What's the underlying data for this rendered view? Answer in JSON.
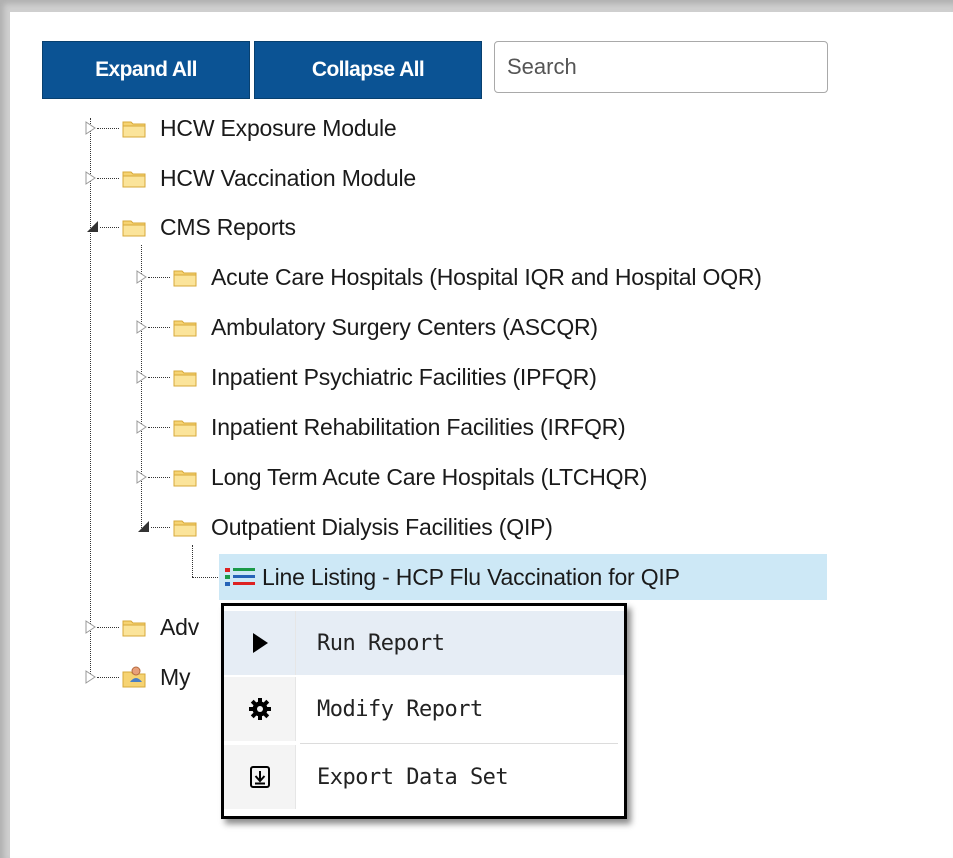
{
  "toolbar": {
    "expand_label": "Expand All",
    "collapse_label": "Collapse All",
    "search_placeholder": "Search"
  },
  "tree": {
    "hcw_exposure": "HCW Exposure Module",
    "hcw_vaccination": "HCW Vaccination Module",
    "cms_reports": "CMS Reports",
    "acute_care": "Acute Care Hospitals (Hospital IQR and Hospital OQR)",
    "ambulatory": "Ambulatory Surgery Centers (ASCQR)",
    "inpatient_psych": "Inpatient Psychiatric Facilities (IPFQR)",
    "inpatient_rehab": "Inpatient Rehabilitation Facilities (IRFQR)",
    "long_term": "Long Term Acute Care Hospitals (LTCHQR)",
    "outpatient_dialysis": "Outpatient Dialysis Facilities (QIP)",
    "line_listing": "Line Listing - HCP Flu Vaccination for QIP",
    "advanced_partial": "Adv",
    "my_partial": "My"
  },
  "context_menu": {
    "run": "Run Report",
    "modify": "Modify Report",
    "export": "Export Data Set"
  },
  "colors": {
    "button_bg": "#0b5394",
    "selected_bg": "#cde8f6",
    "folder": "#f6d372"
  }
}
